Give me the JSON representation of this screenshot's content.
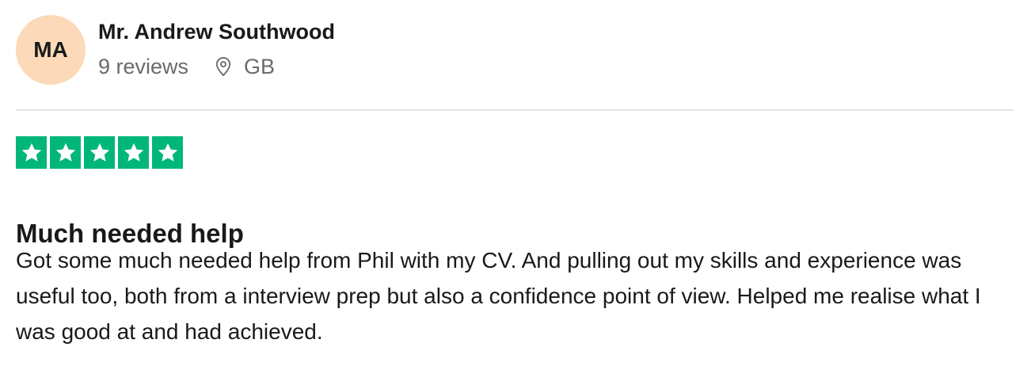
{
  "consumer": {
    "initials": "MA",
    "avatar_color": "#fcd9b8",
    "name": "Mr. Andrew Southwood",
    "review_count": "9 reviews",
    "location_icon": "location-pin-icon",
    "country": "GB"
  },
  "rating": {
    "stars": 5,
    "max_stars": 5,
    "star_color": "#00b67a",
    "star_icon": "star-icon"
  },
  "review": {
    "title": "Much needed help",
    "body": "Got some much needed help from Phil with my CV. And pulling out my skills and experience was useful too, both from a interview prep but also a confidence point of view. Helped me realise what I was good at and had achieved."
  }
}
